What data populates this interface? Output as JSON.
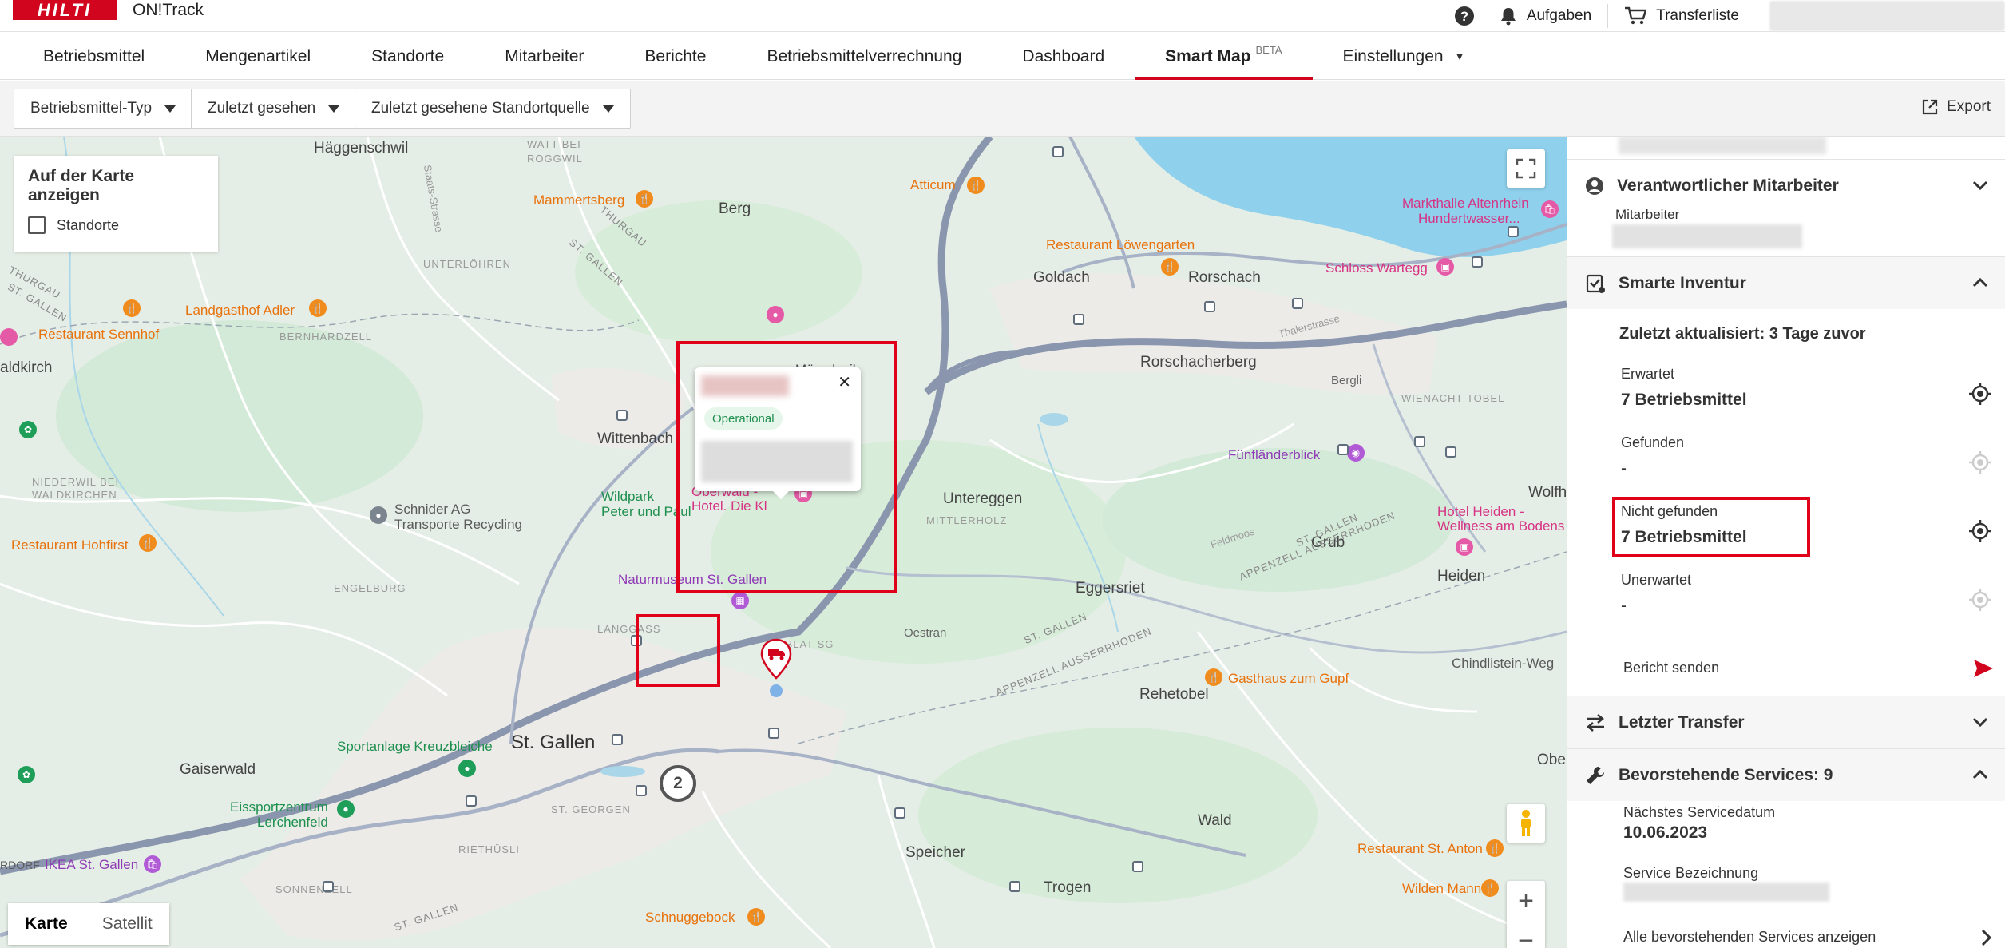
{
  "header": {
    "logo": "HILTI",
    "app_name": "ON!Track",
    "tasks_label": "Aufgaben",
    "transfer_label": "Transferliste",
    "help_icon": "help-icon",
    "bell_icon": "bell-icon",
    "cart_icon": "cart-icon"
  },
  "nav": {
    "items": [
      {
        "label": "Betriebsmittel"
      },
      {
        "label": "Mengenartikel"
      },
      {
        "label": "Standorte"
      },
      {
        "label": "Mitarbeiter"
      },
      {
        "label": "Berichte"
      },
      {
        "label": "Betriebsmittelverrechnung"
      },
      {
        "label": "Dashboard"
      },
      {
        "label": "Smart Map",
        "badge": "BETA",
        "active": true
      },
      {
        "label": "Einstellungen",
        "dropdown": true
      }
    ]
  },
  "filters": {
    "type": "Betriebsmittel-Typ",
    "last_seen": "Zuletzt gesehen",
    "last_seen_source": "Zuletzt gesehene Standortquelle",
    "export": "Export"
  },
  "map": {
    "overlay_title": "Auf der Karte anzeigen",
    "overlay_checkbox": "Standorte",
    "map_type": [
      "Karte",
      "Satellit"
    ],
    "popup_status": "Operational",
    "cluster_count": "2",
    "places": {
      "haeggenschwil": "Häggenschwil",
      "berg": "Berg",
      "goldach": "Goldach",
      "rorschach": "Rorschach",
      "rorschacherberg": "Rorschacherberg",
      "wittenbach": "Wittenbach",
      "untereggen": "Untereggen",
      "eggersriet": "Eggersriet",
      "heiden": "Heiden",
      "grub": "Grub",
      "stgallen": "St. Gallen",
      "gaiserwald": "Gaiserwald",
      "rehetobel": "Rehetobel",
      "wald": "Wald",
      "speicher": "Speicher",
      "trogen": "Trogen",
      "aldkirch": "aldkirch",
      "wolfh": "Wolfh",
      "obere": "Obere"
    },
    "pois": {
      "mammertsberg": "Mammertsberg",
      "atticum": "Atticum",
      "loewengarten": "Restaurant Löwengarten",
      "markthalle1": "Markthalle Altenrhein",
      "markthalle2": "Hundertwasser...",
      "schloss": "Schloss Wartegg",
      "adler": "Landgasthof Adler",
      "sennhof": "Restaurant Sennhof",
      "schnider1": "Schnider AG",
      "schnider2": "Transporte Recycling",
      "wildpark1": "Wildpark",
      "wildpark2": "Peter und Paul",
      "hohfirst": "Restaurant Hohfirst",
      "oberwald1": "Oberwald -",
      "oberwald2": "Hotel. Die Kl",
      "naturmuseum": "Naturmuseum St. Gallen",
      "fuenflaender": "Fünfländerblick",
      "heiden_hotel1": "Hotel Heiden -",
      "heiden_hotel2": "Wellness am Bodens",
      "gupf": "Gasthaus zum Gupf",
      "chindlistein": "Chindlistein-Weg",
      "kreuzbleiche": "Sportanlage Kreuzbleiche",
      "eissport1": "Eissportzentrum",
      "eissport2": "Lerchenfeld",
      "ikea": "IKEA St. Gallen",
      "schnuggebock": "Schnuggebock",
      "stanton": "Restaurant St. Anton",
      "wildenmann": "Wilden Mann",
      "moerschwil": "Mörschwil",
      "rdorf": "RDORF"
    },
    "small_labels": {
      "thurgau1": "THURGAU",
      "thurgau2": "THURGAU",
      "stgallen1": "ST. GALLEN",
      "stgallen2": "ST. GALLEN",
      "stgallen3": "ST. GALLEN",
      "stgallen4": "ST. GALLEN",
      "stgallen5": "ST. GALLEN",
      "appenzell1": "APPENZELL AUSSERRHODEN",
      "appenzell2": "APPENZELL AUSSERRHODEN",
      "unterloehren": "UNTERLÖHREN",
      "bernhardzell": "BERNHARDZELL",
      "watt": "WATT BEI",
      "roggwil": "ROGGWIL",
      "stsgen": "ST. GEORGEN",
      "riethuesli": "RIETHÜSLI",
      "engelburg": "ENGELBURG",
      "niederwil": "NIEDERWIL BEI",
      "wilkirchen": "WALDKIRCHEN",
      "langgass": "LANGGASS",
      "tablat": "TABLAT SG",
      "mittlerholz": "MITTLERHOLZ",
      "wienacht": "WIENACHT-TOBEL",
      "bergli": "Bergli",
      "oestran": "Oestran",
      "sonnezell": "SONNENZELL",
      "staatsstrasse": "Staats-Strasse",
      "feldmoos": "Feldmoos",
      "thalerstrasse": "Thalerstrasse"
    }
  },
  "panel": {
    "resp_title": "Verantwortlicher Mitarbeiter",
    "resp_label": "Mitarbeiter",
    "inv_title": "Smarte Inventur",
    "updated": "Zuletzt aktualisiert: 3 Tage zuvor",
    "expected_label": "Erwartet",
    "expected_value": "7 Betriebsmittel",
    "found_label": "Gefunden",
    "found_value": "-",
    "notfound_label": "Nicht gefunden",
    "notfound_value": "7 Betriebsmittel",
    "unexpected_label": "Unerwartet",
    "unexpected_value": "-",
    "report_label": "Bericht senden",
    "transfer_title": "Letzter Transfer",
    "services_title": "Bevorstehende Services: 9",
    "next_date_label": "Nächstes Servicedatum",
    "next_date_value": "10.06.2023",
    "service_name_label": "Service Bezeichnung",
    "all_services": "Alle bevorstehenden Services anzeigen"
  }
}
